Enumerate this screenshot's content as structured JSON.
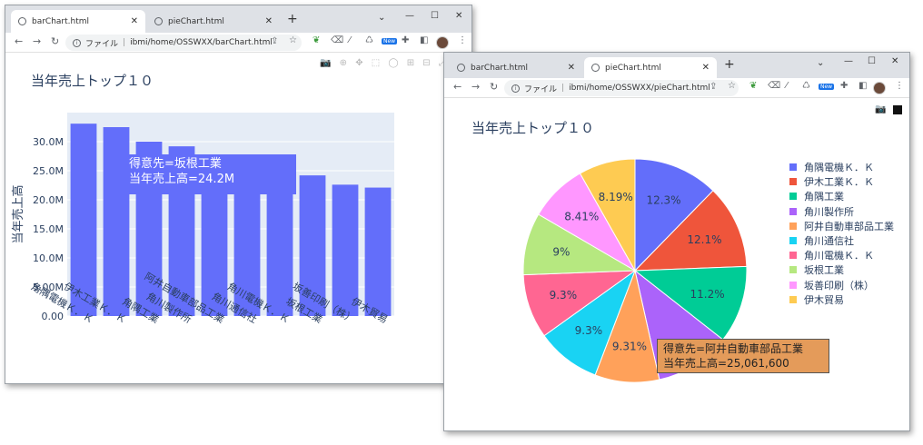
{
  "bar_window": {
    "tabs": [
      {
        "label": "barChart.html",
        "active": true
      },
      {
        "label": "pieChart.html",
        "active": false
      }
    ],
    "address": {
      "protocol_label": "ファイル",
      "path": "ibmi/home/OSSWXX/barChart.html"
    },
    "title": "当年売上トップ１０",
    "tooltip": {
      "line1": "得意先=坂根工業",
      "line2": "当年売上高=24.2M",
      "color": "#636efa"
    },
    "chart_data": {
      "type": "bar",
      "title": "当年売上トップ１０",
      "xlabel": "",
      "ylabel": "当年売上高",
      "categories": [
        "角隅電機Ｋ．Ｋ",
        "伊木工業Ｋ．Ｋ",
        "角隅工業",
        "角川製作所",
        "阿井自動車部品工業",
        "角川通信社",
        "角川電機Ｋ．Ｋ",
        "坂根工業",
        "坂善印刷（株）",
        "伊木貿易"
      ],
      "values": [
        33.1,
        32.5,
        30.0,
        29.2,
        25.1,
        25.0,
        24.9,
        24.2,
        22.6,
        22.1
      ],
      "value_unit": "M",
      "ylim": [
        0,
        35
      ],
      "yticks": [
        "0.00",
        "5.00M",
        "10.0M",
        "15.0M",
        "20.0M",
        "25.0M",
        "30.0M"
      ],
      "grid": true,
      "bar_color": "#636efa"
    }
  },
  "pie_window": {
    "tabs": [
      {
        "label": "barChart.html",
        "active": false
      },
      {
        "label": "pieChart.html",
        "active": true
      }
    ],
    "address": {
      "protocol_label": "ファイル",
      "path": "ibmi/home/OSSWXX/pieChart.html"
    },
    "title": "当年売上トップ１０",
    "tooltip": {
      "line1": "得意先=阿井自動車部品工業",
      "line2": "当年売上高=25,061,600",
      "color": "#e49b5a"
    },
    "chart_data": {
      "type": "pie",
      "title": "当年売上トップ１０",
      "legend_position": "right",
      "slices": [
        {
          "label": "角隅電機Ｋ．Ｋ",
          "percent": 12.3,
          "text": "12.3%",
          "color": "#636efa"
        },
        {
          "label": "伊木工業Ｋ．Ｋ",
          "percent": 12.1,
          "text": "12.1%",
          "color": "#ef553b"
        },
        {
          "label": "角隅工業",
          "percent": 11.2,
          "text": "11.2%",
          "color": "#00cc96"
        },
        {
          "label": "角川製作所",
          "percent": 10.9,
          "text": "",
          "color": "#ab63fa"
        },
        {
          "label": "阿井自動車部品工業",
          "percent": 9.31,
          "text": "9.31%",
          "color": "#ffa15a"
        },
        {
          "label": "角川通信社",
          "percent": 9.3,
          "text": "9.3%",
          "color": "#19d3f3"
        },
        {
          "label": "角川電機Ｋ．Ｋ",
          "percent": 9.3,
          "text": "9.3%",
          "color": "#ff6692"
        },
        {
          "label": "坂根工業",
          "percent": 9.0,
          "text": "9%",
          "color": "#b6e880"
        },
        {
          "label": "坂善印刷（株）",
          "percent": 8.41,
          "text": "8.41%",
          "color": "#ff97ff"
        },
        {
          "label": "伊木貿易",
          "percent": 8.19,
          "text": "8.19%",
          "color": "#fecb52"
        }
      ]
    }
  }
}
